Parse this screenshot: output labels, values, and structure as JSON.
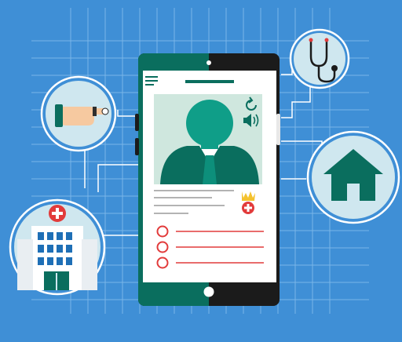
{
  "scene": {
    "colors": {
      "background": "#3f8fd6",
      "grid": "#8ec2ef",
      "phone_teal": "#0a6e5e",
      "phone_dark": "#1b1b1b",
      "screen": "#ffffff",
      "avatar_bg": "#cfe7de",
      "avatar_head": "#0f9e88",
      "avatar_body": "#0a6e5e",
      "accent_red": "#e23b3b",
      "accent_yellow": "#f4c22e",
      "line_gray": "#9a9a9a"
    },
    "icons": [
      "menu-icon",
      "refresh-icon",
      "speaker-icon",
      "badge-cross-icon",
      "stethoscope-icon",
      "home-icon",
      "hand-pulse-icon",
      "hospital-icon"
    ],
    "checklist_items": 3,
    "text_lines": 4
  }
}
